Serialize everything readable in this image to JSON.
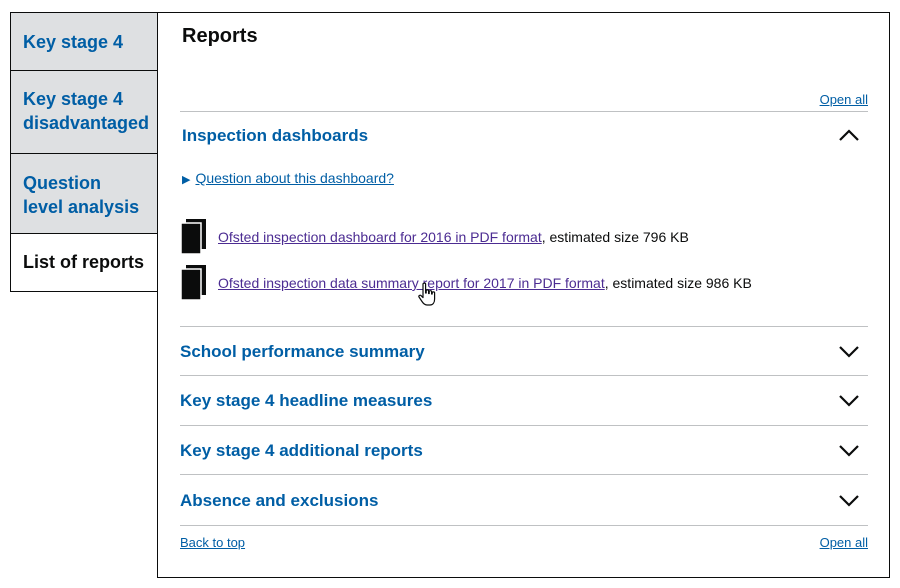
{
  "tabs": [
    {
      "label": "Key stage 4",
      "active": false
    },
    {
      "label": "Key stage 4 disadvantaged",
      "active": false
    },
    {
      "label": "Question level analysis",
      "active": false
    },
    {
      "label": "List of reports",
      "active": true
    }
  ],
  "panel": {
    "title": "Reports",
    "open_all": "Open all",
    "back_to_top": "Back to top"
  },
  "accordion": {
    "expanded": {
      "title": "Inspection dashboards",
      "details_summary": "Question about this dashboard?",
      "documents": [
        {
          "link": "Ofsted inspection dashboard for 2016 in PDF format",
          "suffix": ", estimated size 796 KB"
        },
        {
          "link": "Ofsted inspection data summary report for 2017 in PDF format",
          "suffix": ", estimated size 986 KB"
        }
      ]
    },
    "sections": [
      {
        "title": "School performance summary"
      },
      {
        "title": "Key stage 4 headline measures"
      },
      {
        "title": "Key stage 4 additional reports"
      },
      {
        "title": "Absence and exclusions"
      }
    ]
  },
  "colors": {
    "link": "#005ea5",
    "visited_link": "#4c2c92",
    "tab_background": "#dee0e2",
    "divider": "#bfc1c3"
  },
  "icons": {
    "chevron_up": "chevron-up-icon",
    "chevron_down": "chevron-down-icon",
    "document": "document-icon",
    "cursor": "hand-pointer-cursor-icon"
  }
}
